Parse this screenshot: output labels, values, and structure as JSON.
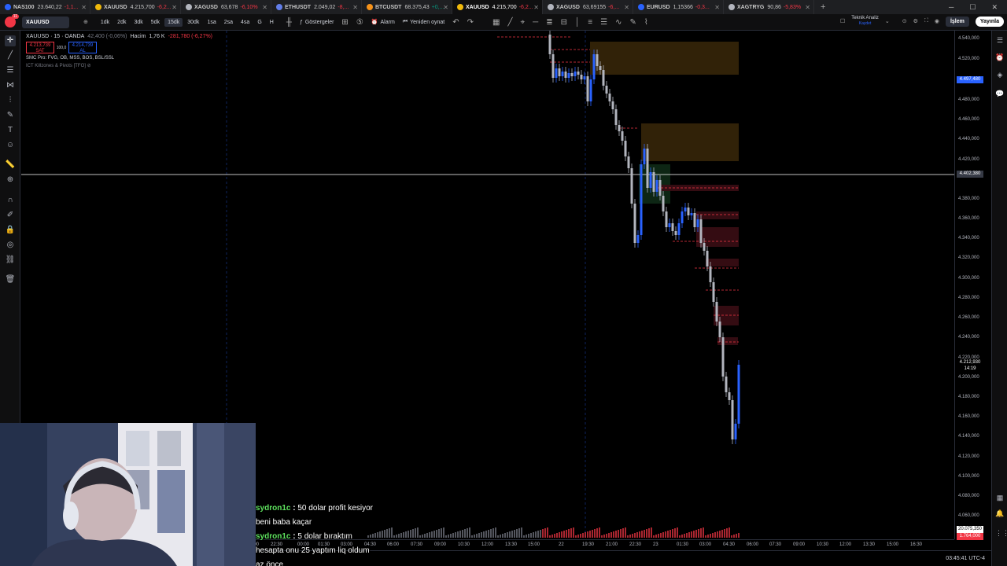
{
  "tabs": [
    {
      "symbol": "NAS100",
      "price": "23.640,22",
      "change": "-1,1...",
      "dot": "#2962ff",
      "active": false
    },
    {
      "symbol": "XAUUSD",
      "price": "4.215,700",
      "change": "-6,2...",
      "dot": "#f0b90b",
      "active": false
    },
    {
      "symbol": "XAGUSD",
      "price": "63,678",
      "change": "-6,10%",
      "dot": "#b2b5be",
      "active": false
    },
    {
      "symbol": "ETHUSDT",
      "price": "2.049,02",
      "change": "-8,...",
      "dot": "#627eea",
      "active": false
    },
    {
      "symbol": "BTCUSDT",
      "price": "68.375,43",
      "change": "+0,...",
      "dot": "#f7931a",
      "active": false
    },
    {
      "symbol": "XAUUSD",
      "price": "4.215,700",
      "change": "-6,2...",
      "dot": "#f0b90b",
      "active": true
    },
    {
      "symbol": "XAGUSD",
      "price": "63,69155",
      "change": "-6,...",
      "dot": "#b2b5be",
      "active": false
    },
    {
      "symbol": "EURUSD",
      "price": "1,15366",
      "change": "-0,3...",
      "dot": "#2962ff",
      "active": false
    },
    {
      "symbol": "XAGTRYG",
      "price": "90,86",
      "change": "-5,83%",
      "dot": "#b2b5be",
      "active": false
    }
  ],
  "toolbar": {
    "symbol": "XAUUSD",
    "timeframes": [
      "1dk",
      "2dk",
      "3dk",
      "5dk",
      "15dk",
      "30dk",
      "1sa",
      "2sa",
      "4sa",
      "G",
      "H"
    ],
    "active_timeframe": "15dk",
    "indicators_label": "Göstergeler",
    "alarm_label": "Alarm",
    "replay_label": "Yeniden oynat",
    "tech_analysis_label": "Teknik Analiz",
    "tech_analysis_sub": "Kaydet",
    "trade_label": "İşlem",
    "publish_label": "Yayınla",
    "notification_count": "11"
  },
  "legend": {
    "title": "XAUUSD · 15 · OANDA",
    "ohlc": "42,400 (-0,06%)",
    "volume_label": "Hacim",
    "volume_value": "1,76 K",
    "volume_change": "-281,780 (-6,27%)",
    "sell_price": "4.213,739",
    "sell_label": "SAT",
    "spread": "100,0",
    "buy_price": "4.214,739",
    "buy_label": "AL",
    "indicator1": "SMC Pro: FVG, OB, MSS, BOS, BSL/SSL",
    "indicator2": "ICT Killzones & Pivots [TFO]"
  },
  "price_scale": {
    "ticks": [
      "4.540,000",
      "4.520,000",
      "4.480,000",
      "4.460,000",
      "4.440,000",
      "4.420,000",
      "4.380,000",
      "4.360,000",
      "4.340,000",
      "4.320,000",
      "4.300,000",
      "4.280,000",
      "4.260,000",
      "4.240,000",
      "4.220,000",
      "4.200,000",
      "4.180,000",
      "4.160,000",
      "4.140,000",
      "4.120,000",
      "4.100,000",
      "4.080,000",
      "4.060,000"
    ],
    "label_blue": "4.497,480",
    "label_crosshair": "4.402,380",
    "label_current": "4.212,930",
    "label_countdown": "14:19",
    "label_vol1": "20.075,350",
    "label_vol2": "1.764,000"
  },
  "time_scale": {
    "ticks": [
      "21:00",
      "22:30",
      "00:00",
      "01:30",
      "03:00",
      "04:30",
      "06:00",
      "07:30",
      "09:00",
      "10:30",
      "12:00",
      "13:30",
      "15:00",
      "22",
      "19:30",
      "21:00",
      "22:30",
      "23",
      "01:30",
      "03:00",
      "04:30",
      "06:00",
      "07:30",
      "09:00",
      "10:30",
      "12:00",
      "13:30",
      "15:00",
      "16:30"
    ]
  },
  "status": {
    "clock": "03:45:41 UTC-4"
  },
  "chat": [
    {
      "user": "sydron1c",
      "text": "50 dolar profit kesiyor"
    },
    {
      "user": "",
      "text": "beni baba kaçar"
    },
    {
      "user": "sydron1c",
      "text": "5 dolar bıraktım"
    },
    {
      "user": "",
      "text": "hesapta onu 25 yaptım liq oldum"
    },
    {
      "user": "",
      "text": "az önce"
    }
  ],
  "colors": {
    "bull": "#2962ff",
    "bear": "#b2b5be",
    "fvg_bear": "#f23645",
    "ob_orange": "#f0b90b"
  }
}
